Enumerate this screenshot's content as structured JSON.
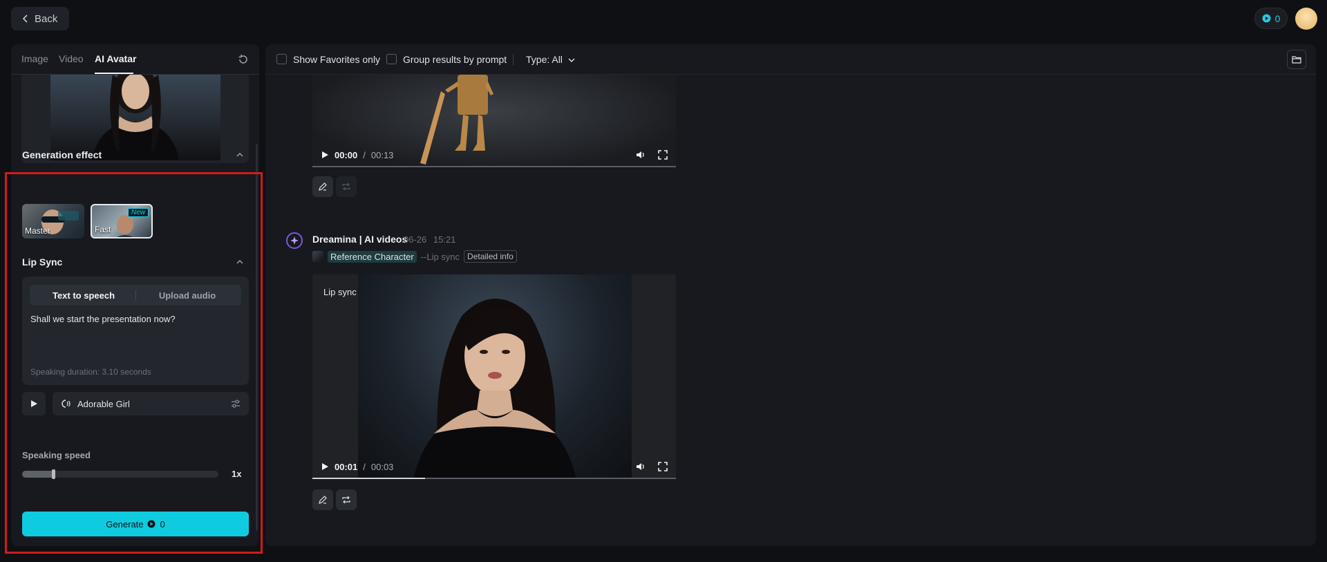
{
  "header": {
    "back_label": "Back",
    "credits": "0"
  },
  "left": {
    "tabs": [
      {
        "label": "Image"
      },
      {
        "label": "Video"
      },
      {
        "label": "AI Avatar"
      }
    ],
    "generation_effect": {
      "title": "Generation effect",
      "options": [
        {
          "label": "Master"
        },
        {
          "label": "Fast",
          "badge": "New"
        }
      ]
    },
    "lip_sync": {
      "title": "Lip Sync",
      "modes": [
        "Text to speech",
        "Upload audio"
      ],
      "text": "Shall we start the presentation now?",
      "duration": "Speaking duration: 3.10 seconds",
      "voice": "Adorable Girl"
    },
    "speed": {
      "label": "Speaking speed",
      "value_text": "1x",
      "level": 0.16
    },
    "generate": {
      "label": "Generate",
      "cost": "0"
    }
  },
  "right": {
    "filters": {
      "favorites": "Show Favorites only",
      "group": "Group results by prompt",
      "type": "Type: All"
    },
    "video1": {
      "current": "00:00",
      "separator": "/",
      "total": "00:13",
      "progress": 0
    },
    "generation": {
      "title": "Dreamina | AI videos",
      "date": "06-26",
      "time": "15:21",
      "reference": "Reference Character",
      "mode": "--Lip sync",
      "detail": "Detailed info"
    },
    "video2": {
      "tag": "Lip sync",
      "current": "00:01",
      "separator": "/",
      "total": "00:03",
      "progress": 0.31
    }
  },
  "colors": {
    "accent": "#0fcbe0",
    "highlight_frame": "#d41a1a",
    "brand_purple": "#7a5ad8"
  }
}
